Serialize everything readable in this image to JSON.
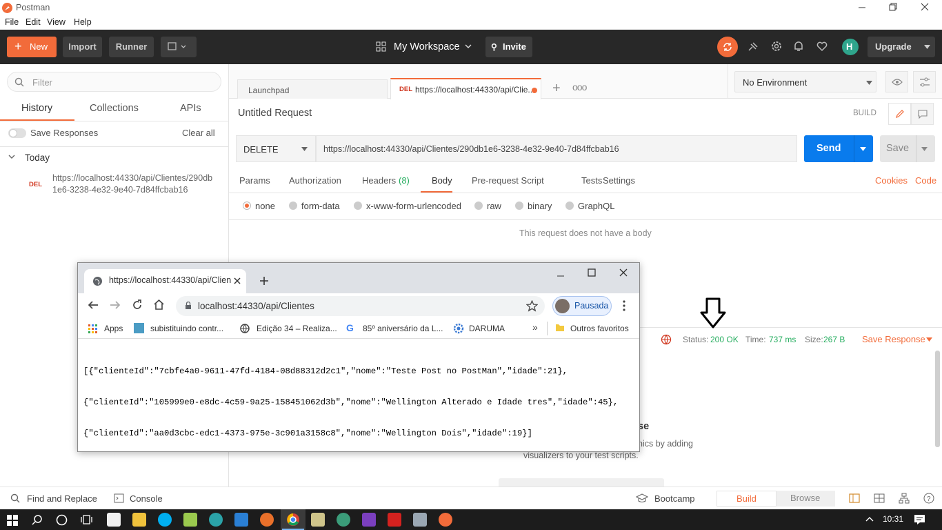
{
  "window": {
    "title": "Postman",
    "menu": [
      "File",
      "Edit",
      "View",
      "Help"
    ]
  },
  "header": {
    "new_label": "New",
    "import_label": "Import",
    "runner_label": "Runner",
    "workspace_label": "My Workspace",
    "invite_label": "Invite",
    "upgrade_label": "Upgrade"
  },
  "sidebar": {
    "filter_placeholder": "Filter",
    "tabs": [
      "History",
      "Collections",
      "APIs"
    ],
    "save_responses_label": "Save Responses",
    "clear_all_label": "Clear all",
    "group_label": "Today",
    "history_item": {
      "method": "DEL",
      "url_line1": "https://localhost:44330/api/Clientes/290db",
      "url_line2": "1e6-3238-4e32-9e40-7d84ffcbab16"
    }
  },
  "tabs": {
    "launchpad_label": "Launchpad",
    "active_method": "DEL",
    "active_label": "https://localhost:44330/api/Clie..."
  },
  "environment": {
    "selected": "No Environment"
  },
  "request": {
    "title": "Untitled Request",
    "build_label": "BUILD",
    "method": "DELETE",
    "url": "https://localhost:44330/api/Clientes/290db1e6-3238-4e32-9e40-7d84ffcbab16",
    "send_label": "Send",
    "save_label": "Save",
    "subtabs": [
      "Params",
      "Authorization",
      "Headers",
      "Body",
      "Pre-request Script",
      "Tests",
      "Settings"
    ],
    "headers_count": "(8)",
    "cookies_label": "Cookies",
    "code_label": "Code",
    "body_types": [
      "none",
      "form-data",
      "x-www-form-urlencoded",
      "raw",
      "binary",
      "GraphQL"
    ],
    "no_body_text": "This request does not have a body"
  },
  "response": {
    "status_label": "Status:",
    "status_value": "200 OK",
    "time_label": "Time:",
    "time_value": "737 ms",
    "size_label": "Size:",
    "size_value": "267 B",
    "save_response_label": "Save Response",
    "visualize_heading_fragment": "se",
    "visualize_text_line1": "nics by adding",
    "visualize_text_line2": "visualizers to your test scripts."
  },
  "statusbar": {
    "find_replace_label": "Find and Replace",
    "console_label": "Console",
    "bootcamp_label": "Bootcamp",
    "build_label": "Build",
    "browse_label": "Browse"
  },
  "chrome": {
    "tab_title": "https://localhost:44330/api/Clien",
    "address": "localhost:44330/api/Clientes",
    "profile_label": "Pausada",
    "bookmarks": [
      "Apps",
      "subistituindo contr...",
      "Edição 34 – Realiza...",
      "85º aniversário da L...",
      "DARUMA"
    ],
    "other_bookmarks": "Outros favoritos",
    "json_line1": "[{\"clienteId\":\"7cbfe4a0-9611-47fd-4184-08d88312d2c1\",\"nome\":\"Teste Post no PostMan\",\"idade\":21},",
    "json_line2": "{\"clienteId\":\"105999e0-e8dc-4c59-9a25-158451062d3b\",\"nome\":\"Wellington Alterado e Idade tres\",\"idade\":45},",
    "json_line3": "{\"clienteId\":\"aa0d3cbc-edc1-4373-975e-3c901a3158c8\",\"nome\":\"Wellington Dois\",\"idade\":19}]"
  },
  "taskbar": {
    "clock": "10:31"
  },
  "colors": {
    "accent": "#f26b3a",
    "send_blue": "#097bed",
    "header_bg": "#282828",
    "status_ok": "#27ae60"
  }
}
